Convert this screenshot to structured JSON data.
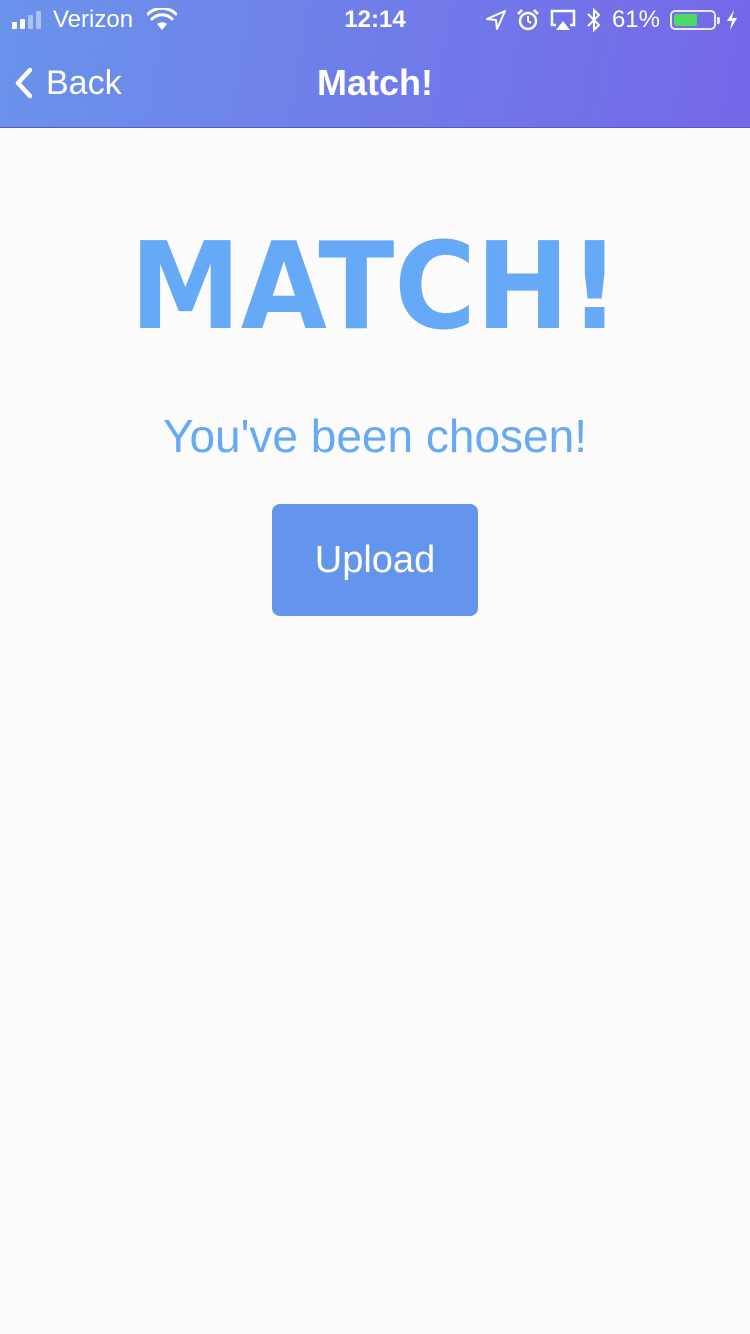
{
  "status_bar": {
    "carrier": "Verizon",
    "time": "12:14",
    "battery_percent_label": "61%",
    "battery_level": 0.61,
    "battery_color": "#4cd964",
    "icons": [
      "signal-icon",
      "wifi-icon",
      "location-arrow-icon",
      "alarm-icon",
      "airplay-icon",
      "bluetooth-icon",
      "battery-icon",
      "charging-bolt-icon"
    ]
  },
  "nav": {
    "back_label": "Back",
    "title": "Match!",
    "gradient_start": "#6a93ea",
    "gradient_end": "#7567e8"
  },
  "main": {
    "headline": "MATCH!",
    "headline_color": "#66a9f6",
    "subtitle": "You've been chosen!",
    "upload_label": "Upload",
    "button_color": "#6495ed"
  }
}
